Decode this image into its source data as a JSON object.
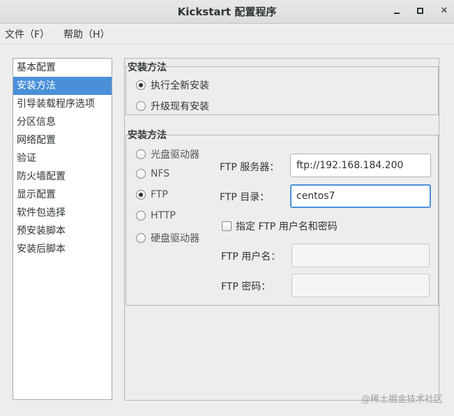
{
  "window": {
    "title": "Kickstart 配置程序",
    "minimize_label": "–",
    "maximize_label": "□",
    "close_label": "✕"
  },
  "menubar": {
    "items": [
      {
        "label": "文件（F）"
      },
      {
        "label": "帮助（H）"
      }
    ]
  },
  "sidebar": {
    "selected_index": 1,
    "items": [
      {
        "label": "基本配置"
      },
      {
        "label": "安装方法"
      },
      {
        "label": "引导装载程序选项"
      },
      {
        "label": "分区信息"
      },
      {
        "label": "网络配置"
      },
      {
        "label": "验证"
      },
      {
        "label": "防火墙配置"
      },
      {
        "label": "显示配置"
      },
      {
        "label": "软件包选择"
      },
      {
        "label": "预安装脚本"
      },
      {
        "label": "安装后脚本"
      }
    ]
  },
  "install_type": {
    "section_title": "安装方法",
    "options": [
      {
        "label": "执行全新安装",
        "checked": true
      },
      {
        "label": "升级现有安装",
        "checked": false
      }
    ]
  },
  "install_method": {
    "section_title": "安装方法",
    "options": [
      {
        "label": "光盘驱动器",
        "checked": false
      },
      {
        "label": "NFS",
        "checked": false
      },
      {
        "label": "FTP",
        "checked": true
      },
      {
        "label": "HTTP",
        "checked": false
      },
      {
        "label": "硬盘驱动器",
        "checked": false
      }
    ]
  },
  "ftp": {
    "server_label": "FTP 服务器：",
    "server_value": "ftp://192.168.184.200",
    "directory_label": "FTP 目录：",
    "directory_value": "centos7",
    "specify_credentials_label": "指定  FTP 用户名和密码",
    "specify_credentials_checked": false,
    "username_label": "FTP 用户名：",
    "username_value": "",
    "password_label": "FTP 密码：",
    "password_value": ""
  },
  "watermark": {
    "text": "@稀土掘金技术社区"
  }
}
